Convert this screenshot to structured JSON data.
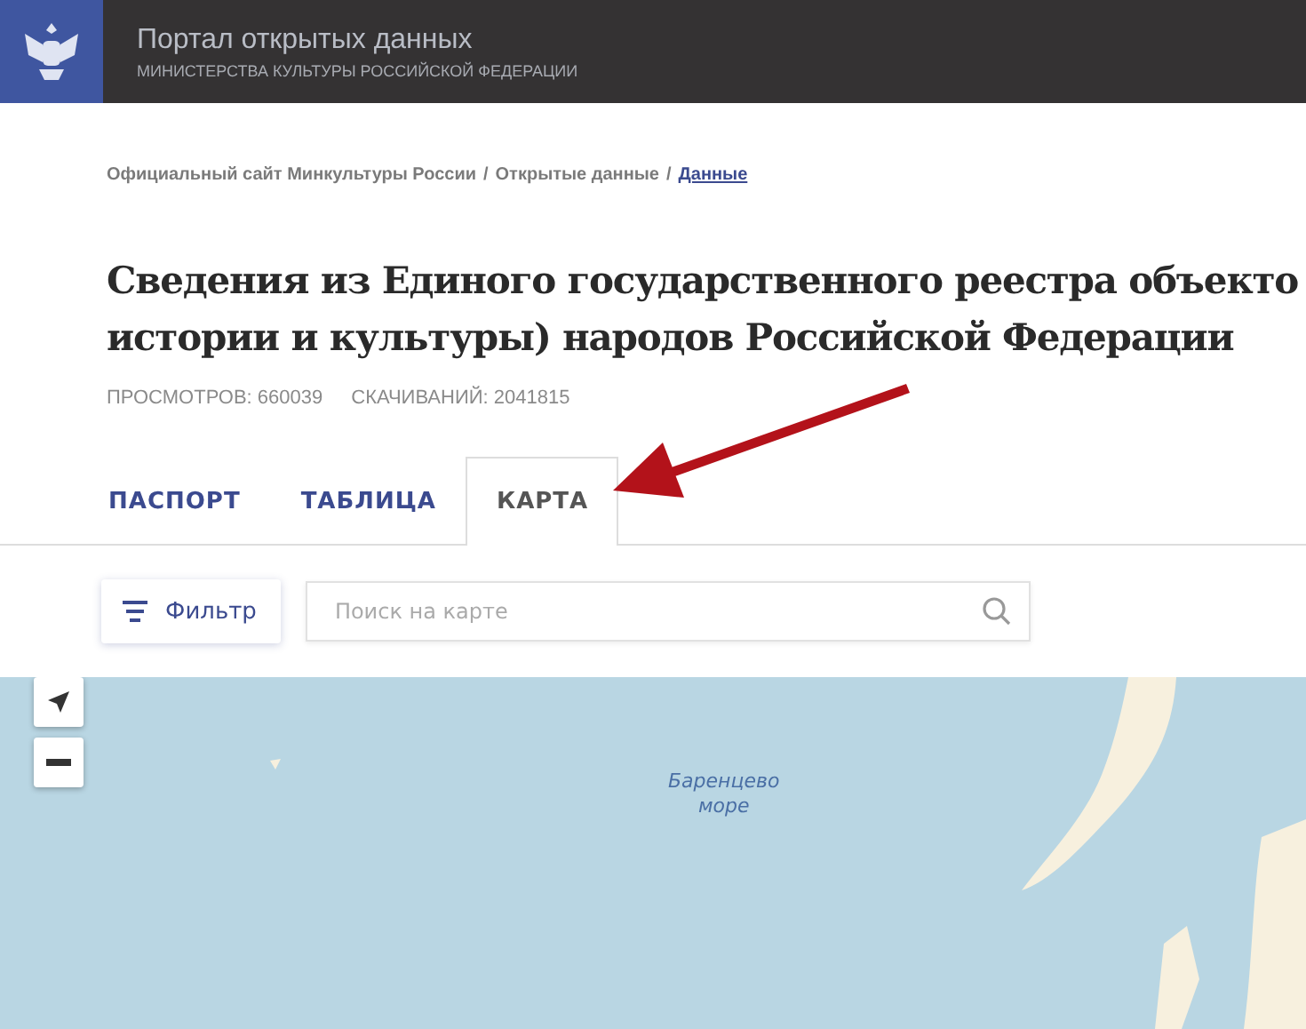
{
  "header": {
    "title": "Портал открытых данных",
    "subtitle": "МИНИСТЕРСТВА КУЛЬТУРЫ РОССИЙСКОЙ ФЕДЕРАЦИИ"
  },
  "breadcrumbs": [
    {
      "label": "Официальный сайт Минкультуры России",
      "link": false
    },
    {
      "label": "Открытые данные",
      "link": false
    },
    {
      "label": "Данные",
      "link": true
    }
  ],
  "breadcrumb_separator": "/",
  "title_lines": [
    "Сведения из Единого государственного реестра объекто",
    "истории и культуры) народов Российской Федерации"
  ],
  "stats": [
    "ПРОСМОТРОВ: 660039",
    "СКАЧИВАНИЙ: 2041815"
  ],
  "tabs": [
    {
      "label": "ПАСПОРТ",
      "selected": false
    },
    {
      "label": "ТАБЛИЦА",
      "selected": false
    },
    {
      "label": "КАРТА",
      "selected": true
    }
  ],
  "filter_button": "Фильтр",
  "search": {
    "placeholder": "Поиск на карте"
  },
  "map": {
    "labels": [
      "Баренцево",
      "море"
    ]
  }
}
